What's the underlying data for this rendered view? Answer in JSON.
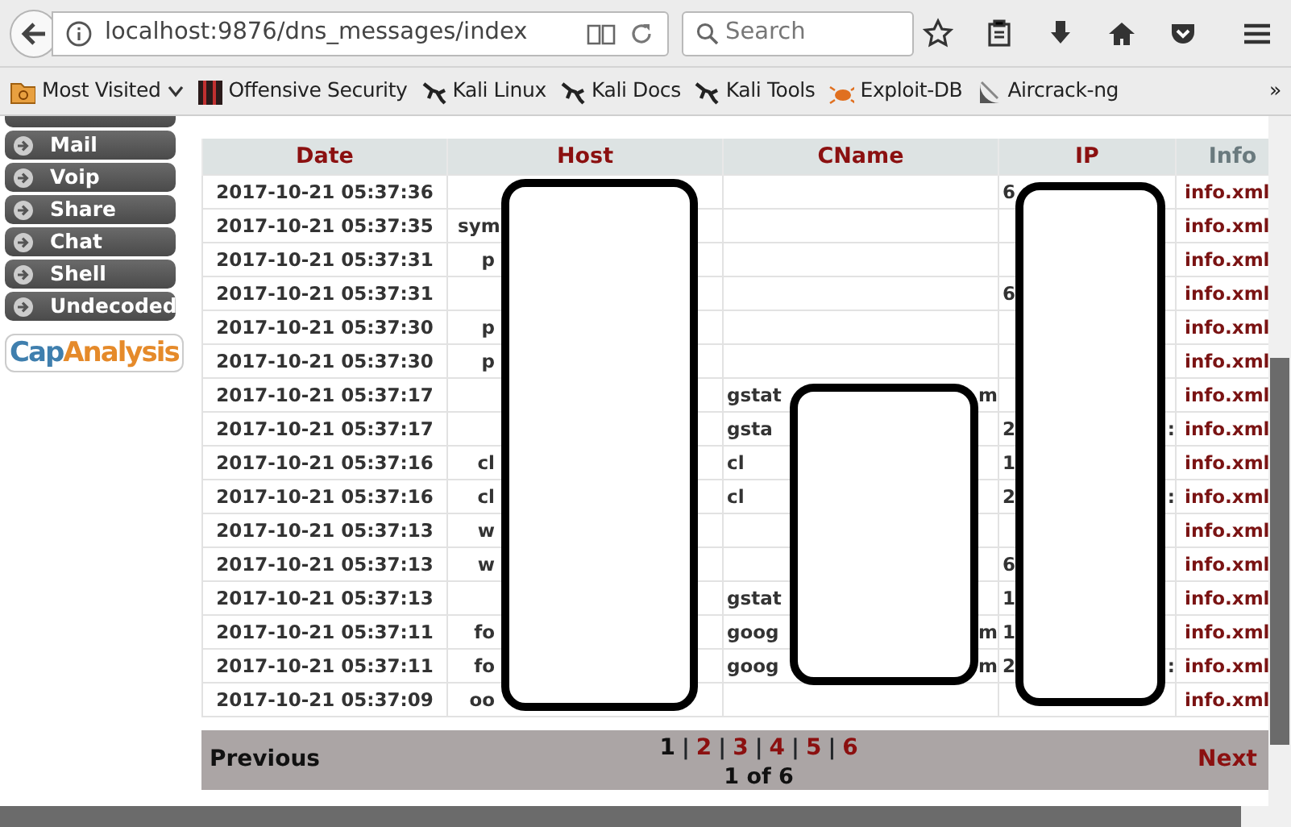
{
  "browser": {
    "url": "localhost:9876/dns_messages/index",
    "search": {
      "placeholder": "Search"
    },
    "bookmarks": [
      {
        "label": "Most Visited",
        "dropdown": true
      },
      {
        "label": "Offensive Security",
        "dropdown": false
      },
      {
        "label": "Kali Linux",
        "dropdown": false
      },
      {
        "label": "Kali Docs",
        "dropdown": false
      },
      {
        "label": "Kali Tools",
        "dropdown": false
      },
      {
        "label": "Exploit-DB",
        "dropdown": false
      },
      {
        "label": "Aircrack-ng",
        "dropdown": false
      }
    ],
    "overflow": "»"
  },
  "sidebar": {
    "items": [
      {
        "label": "Mail"
      },
      {
        "label": "Voip"
      },
      {
        "label": "Share"
      },
      {
        "label": "Chat"
      },
      {
        "label": "Shell"
      },
      {
        "label": "Undecoded"
      }
    ],
    "logo_lead": "Cap",
    "logo_tail": "Analysis"
  },
  "table": {
    "columns": [
      "Date",
      "Host",
      "CName",
      "IP",
      "Info"
    ],
    "rows": [
      {
        "date": "2017-10-21 05:37:36",
        "ip": "6",
        "info": "info.xml"
      },
      {
        "date": "2017-10-21 05:37:35",
        "host": "sym",
        "info": "info.xml"
      },
      {
        "date": "2017-10-21 05:37:31",
        "host": "p",
        "info": "info.xml"
      },
      {
        "date": "2017-10-21 05:37:31",
        "ip": "6",
        "info": "info.xml"
      },
      {
        "date": "2017-10-21 05:37:30",
        "host": "p",
        "info": "info.xml"
      },
      {
        "date": "2017-10-21 05:37:30",
        "host": "p",
        "info": "info.xml"
      },
      {
        "date": "2017-10-21 05:37:17",
        "cname": "gstat",
        "cname_tail": "m",
        "info": "info.xml"
      },
      {
        "date": "2017-10-21 05:37:17",
        "cname": "gsta",
        "ip": "2",
        "ip_tail": ":",
        "info": "info.xml"
      },
      {
        "date": "2017-10-21 05:37:16",
        "host": "cl",
        "cname": "cl",
        "ip": "1",
        "info": "info.xml"
      },
      {
        "date": "2017-10-21 05:37:16",
        "host": "cl",
        "cname": "cl",
        "ip": "2",
        "ip_tail": ":",
        "info": "info.xml"
      },
      {
        "date": "2017-10-21 05:37:13",
        "host": "w",
        "info": "info.xml"
      },
      {
        "date": "2017-10-21 05:37:13",
        "host": "w",
        "ip": "6",
        "info": "info.xml"
      },
      {
        "date": "2017-10-21 05:37:13",
        "cname": "gstat",
        "ip": "1",
        "info": "info.xml"
      },
      {
        "date": "2017-10-21 05:37:11",
        "host": "fo",
        "cname": "goog",
        "cname_tail": "m",
        "ip": "1",
        "info": "info.xml"
      },
      {
        "date": "2017-10-21 05:37:11",
        "host": "fo",
        "cname": "goog",
        "cname_tail": "m",
        "ip": "2",
        "ip_tail": ":",
        "info": "info.xml"
      },
      {
        "date": "2017-10-21 05:37:09",
        "host": "oo",
        "info": "info.xml"
      }
    ]
  },
  "pagination": {
    "previous": "Previous",
    "next": "Next",
    "separator": "|",
    "pages": [
      {
        "label": "1",
        "selected": true
      },
      {
        "label": "2",
        "selected": false
      },
      {
        "label": "3",
        "selected": false
      },
      {
        "label": "4",
        "selected": false
      },
      {
        "label": "5",
        "selected": false
      },
      {
        "label": "6",
        "selected": false
      }
    ],
    "summary": "1 of 6"
  }
}
